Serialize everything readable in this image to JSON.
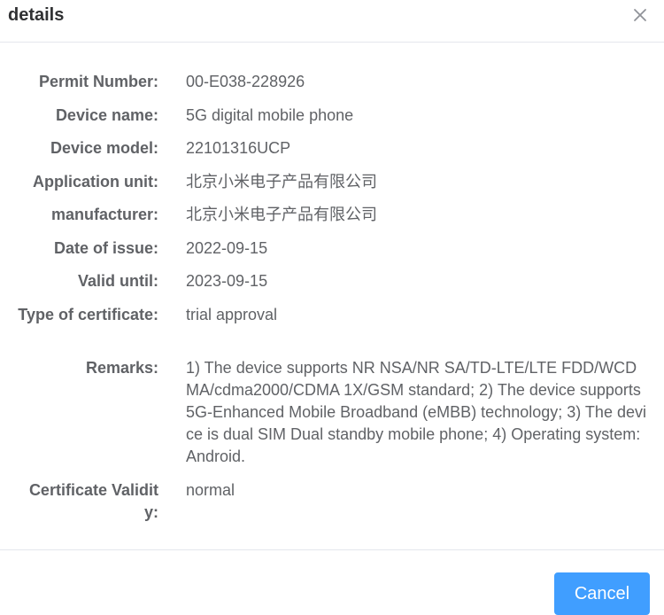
{
  "dialog": {
    "title": "details",
    "close_icon": "close-icon",
    "cancel_label": "Cancel"
  },
  "fields": {
    "permit_number": {
      "label": "Permit Number:",
      "value": "00-E038-228926"
    },
    "device_name": {
      "label": "Device name:",
      "value": "5G digital mobile phone"
    },
    "device_model": {
      "label": "Device model:",
      "value": "22101316UCP"
    },
    "application_unit": {
      "label": "Application unit:",
      "value": "北京小米电子产品有限公司"
    },
    "manufacturer": {
      "label": "manufacturer:",
      "value": "北京小米电子产品有限公司"
    },
    "date_of_issue": {
      "label": "Date of issue:",
      "value": "2022-09-15"
    },
    "valid_until": {
      "label": "Valid until:",
      "value": "2023-09-15"
    },
    "type_of_certificate": {
      "label": "Type of certificate:",
      "value": "trial approval"
    },
    "remarks": {
      "label": "Remarks:",
      "value": "1) The device supports NR NSA/NR SA/TD-LTE/LTE FDD/WCDMA/cdma2000/CDMA 1X/GSM standard; 2) The device supports 5G-Enhanced Mobile Broadband (eMBB) technology; 3) The device is dual SIM Dual standby mobile phone; 4) Operating system: Android."
    },
    "certificate_validity": {
      "label": "Certificate Validity:",
      "value": "normal"
    }
  },
  "colors": {
    "primary": "#409eff",
    "text": "#606266",
    "title": "#303133",
    "divider": "#e4e7ed"
  }
}
